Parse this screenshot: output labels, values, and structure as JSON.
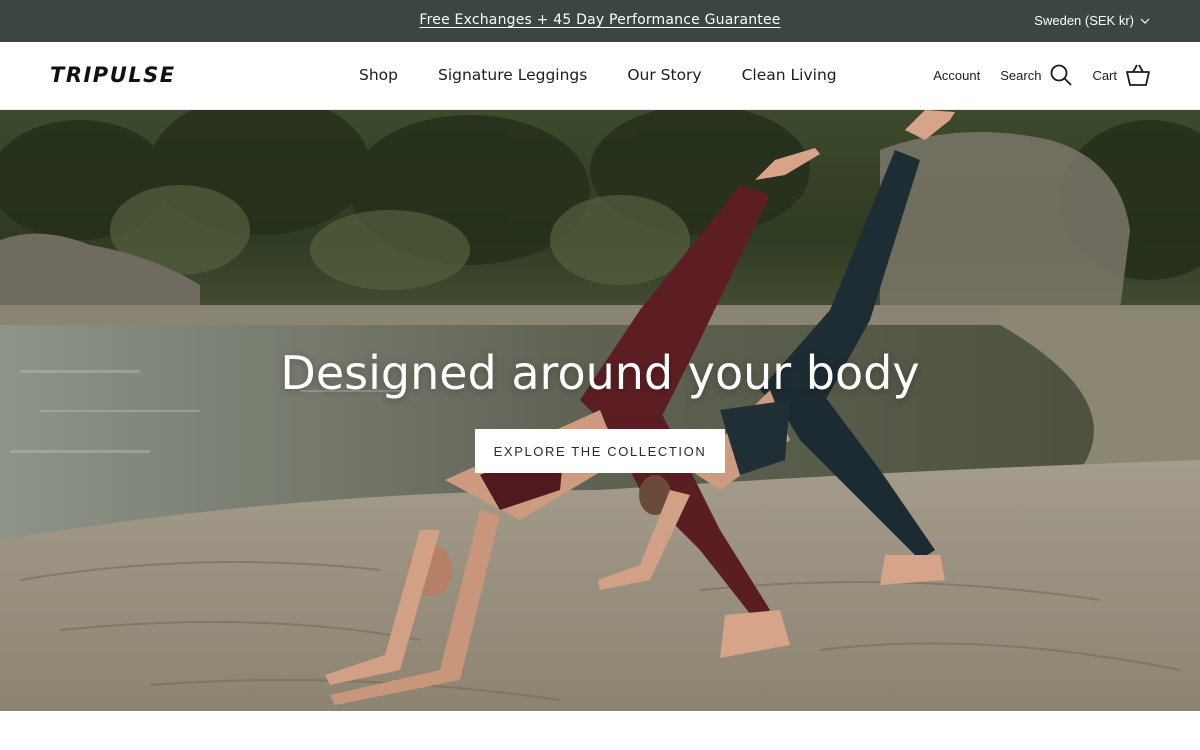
{
  "announcement": {
    "text": "Free Exchanges + 45 Day Performance Guarantee",
    "locale": "Sweden (SEK kr)"
  },
  "header": {
    "logo": "TRIPULSE",
    "nav": [
      "Shop",
      "Signature Leggings",
      "Our Story",
      "Clean Living"
    ],
    "account_label": "Account",
    "search_label": "Search",
    "cart_label": "Cart"
  },
  "hero": {
    "title": "Designed around your body",
    "cta_label": "EXPLORE THE COLLECTION"
  },
  "colors": {
    "announcement_bg": "#3b4641",
    "text": "#1d1d1d",
    "cta_bg": "#ffffff"
  },
  "icons": [
    "chevron-down-icon",
    "search-icon",
    "cart-icon"
  ]
}
